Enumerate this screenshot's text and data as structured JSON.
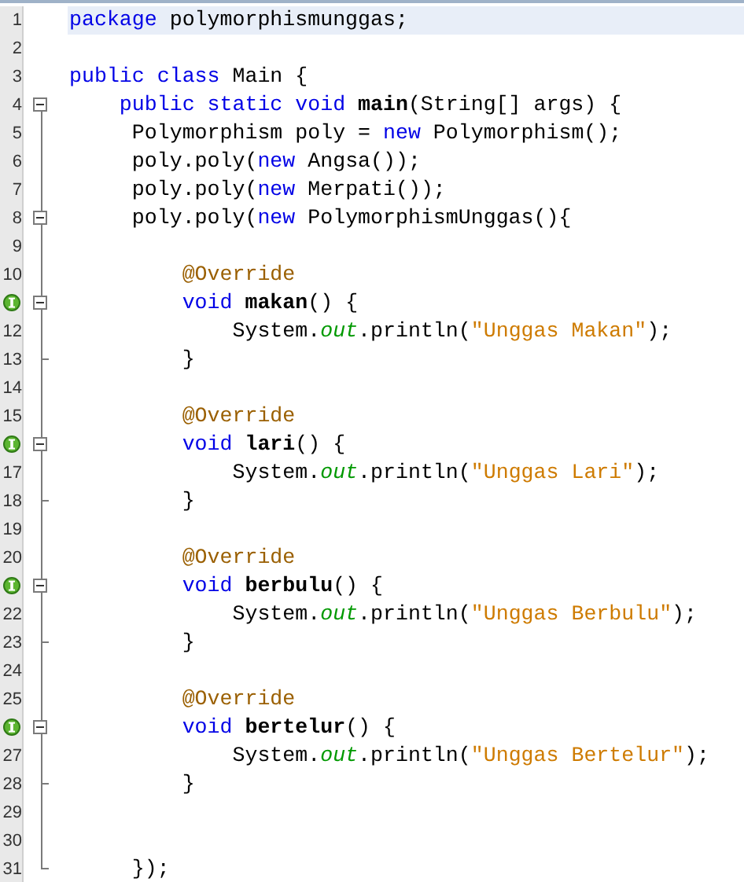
{
  "editor": {
    "lines": [
      {
        "number": "1",
        "current": true,
        "tokens": [
          {
            "kind": "keyword",
            "text": "package"
          },
          {
            "kind": "plain",
            "text": " polymorphismunggas;"
          }
        ]
      },
      {
        "number": "2"
      },
      {
        "number": "3",
        "tokens": [
          {
            "kind": "keyword",
            "text": "public class"
          },
          {
            "kind": "plain",
            "text": " Main {"
          }
        ]
      },
      {
        "number": "4",
        "fold_toggle": true,
        "tokens": [
          {
            "kind": "keyword",
            "text": "    public static void "
          },
          {
            "kind": "method",
            "text": "main"
          },
          {
            "kind": "plain",
            "text": "(String[] args) {"
          }
        ]
      },
      {
        "number": "5",
        "tokens": [
          {
            "kind": "plain",
            "text": "     Polymorphism poly = "
          },
          {
            "kind": "keyword",
            "text": "new"
          },
          {
            "kind": "plain",
            "text": " Polymorphism();"
          }
        ]
      },
      {
        "number": "6",
        "tokens": [
          {
            "kind": "plain",
            "text": "     poly.poly("
          },
          {
            "kind": "keyword",
            "text": "new"
          },
          {
            "kind": "plain",
            "text": " Angsa());"
          }
        ]
      },
      {
        "number": "7",
        "tokens": [
          {
            "kind": "plain",
            "text": "     poly.poly("
          },
          {
            "kind": "keyword",
            "text": "new"
          },
          {
            "kind": "plain",
            "text": " Merpati());"
          }
        ]
      },
      {
        "number": "8",
        "fold_toggle": true,
        "tokens": [
          {
            "kind": "plain",
            "text": "     poly.poly("
          },
          {
            "kind": "keyword",
            "text": "new"
          },
          {
            "kind": "plain",
            "text": " PolymorphismUnggas(){"
          }
        ]
      },
      {
        "number": "9"
      },
      {
        "number": "10",
        "tokens": [
          {
            "kind": "annotation",
            "text": "         @Override"
          }
        ]
      },
      {
        "fold_toggle": true,
        "override": true,
        "tokens": [
          {
            "kind": "keyword",
            "text": "         void "
          },
          {
            "kind": "method",
            "text": "makan"
          },
          {
            "kind": "plain",
            "text": "() {"
          }
        ]
      },
      {
        "number": "12",
        "tokens": [
          {
            "kind": "plain",
            "text": "             System."
          },
          {
            "kind": "field",
            "text": "out"
          },
          {
            "kind": "plain",
            "text": ".println("
          },
          {
            "kind": "string",
            "text": "\"Unggas Makan\""
          },
          {
            "kind": "plain",
            "text": ");"
          }
        ]
      },
      {
        "number": "13",
        "fold_end": true,
        "tokens": [
          {
            "kind": "plain",
            "text": "         }"
          }
        ]
      },
      {
        "number": "14"
      },
      {
        "number": "15",
        "tokens": [
          {
            "kind": "annotation",
            "text": "         @Override"
          }
        ]
      },
      {
        "fold_toggle": true,
        "override": true,
        "tokens": [
          {
            "kind": "keyword",
            "text": "         void "
          },
          {
            "kind": "method",
            "text": "lari"
          },
          {
            "kind": "plain",
            "text": "() {"
          }
        ]
      },
      {
        "number": "17",
        "tokens": [
          {
            "kind": "plain",
            "text": "             System."
          },
          {
            "kind": "field",
            "text": "out"
          },
          {
            "kind": "plain",
            "text": ".println("
          },
          {
            "kind": "string",
            "text": "\"Unggas Lari\""
          },
          {
            "kind": "plain",
            "text": ");"
          }
        ]
      },
      {
        "number": "18",
        "fold_end": true,
        "tokens": [
          {
            "kind": "plain",
            "text": "         }"
          }
        ]
      },
      {
        "number": "19"
      },
      {
        "number": "20",
        "tokens": [
          {
            "kind": "annotation",
            "text": "         @Override"
          }
        ]
      },
      {
        "fold_toggle": true,
        "override": true,
        "tokens": [
          {
            "kind": "keyword",
            "text": "         void "
          },
          {
            "kind": "method",
            "text": "berbulu"
          },
          {
            "kind": "plain",
            "text": "() {"
          }
        ]
      },
      {
        "number": "22",
        "tokens": [
          {
            "kind": "plain",
            "text": "             System."
          },
          {
            "kind": "field",
            "text": "out"
          },
          {
            "kind": "plain",
            "text": ".println("
          },
          {
            "kind": "string",
            "text": "\"Unggas Berbulu\""
          },
          {
            "kind": "plain",
            "text": ");"
          }
        ]
      },
      {
        "number": "23",
        "fold_end": true,
        "tokens": [
          {
            "kind": "plain",
            "text": "         }"
          }
        ]
      },
      {
        "number": "24"
      },
      {
        "number": "25",
        "tokens": [
          {
            "kind": "annotation",
            "text": "         @Override"
          }
        ]
      },
      {
        "fold_toggle": true,
        "override": true,
        "tokens": [
          {
            "kind": "keyword",
            "text": "         void "
          },
          {
            "kind": "method",
            "text": "bertelur"
          },
          {
            "kind": "plain",
            "text": "() {"
          }
        ]
      },
      {
        "number": "27",
        "tokens": [
          {
            "kind": "plain",
            "text": "             System."
          },
          {
            "kind": "field",
            "text": "out"
          },
          {
            "kind": "plain",
            "text": ".println("
          },
          {
            "kind": "string",
            "text": "\"Unggas Bertelur\""
          },
          {
            "kind": "plain",
            "text": ");"
          }
        ]
      },
      {
        "number": "28",
        "fold_end": true,
        "tokens": [
          {
            "kind": "plain",
            "text": "         }"
          }
        ]
      },
      {
        "number": "29"
      },
      {
        "number": "30"
      },
      {
        "number": "31",
        "fold_end": true,
        "tokens": [
          {
            "kind": "plain",
            "text": "     });"
          }
        ]
      }
    ]
  }
}
